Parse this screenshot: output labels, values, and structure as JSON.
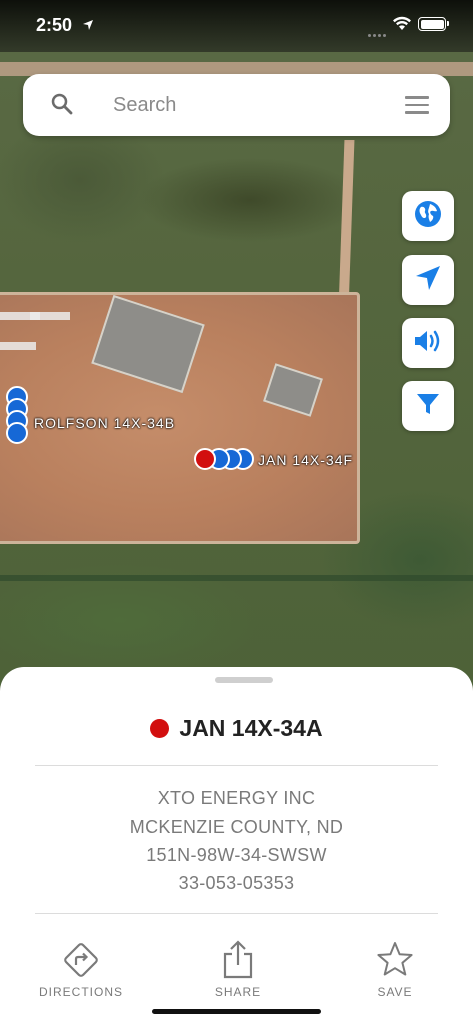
{
  "status_bar": {
    "time": "2:50"
  },
  "search": {
    "placeholder": "Search"
  },
  "map": {
    "wells": [
      {
        "label": "ROLFSON 14X-34B"
      },
      {
        "label": "JAN 14X-34F"
      }
    ]
  },
  "map_controls": [
    {
      "name": "globe-icon",
      "color": "#1a7fe6"
    },
    {
      "name": "location-arrow-icon",
      "color": "#1a7fe6"
    },
    {
      "name": "speaker-icon",
      "color": "#1a7fe6"
    },
    {
      "name": "filter-icon",
      "color": "#1a7fe6"
    }
  ],
  "detail": {
    "title": "JAN 14X-34A",
    "status_color": "#d20f0f",
    "operator": "XTO ENERGY INC",
    "county": "MCKENZIE COUNTY, ND",
    "location": "151N-98W-34-SWSW",
    "api": "33-053-05353"
  },
  "actions": {
    "directions": "DIRECTIONS",
    "share": "SHARE",
    "save": "SAVE"
  },
  "colors": {
    "accent": "#1a7fe6",
    "well_blue": "#1668d6",
    "well_red": "#d20f0f"
  }
}
